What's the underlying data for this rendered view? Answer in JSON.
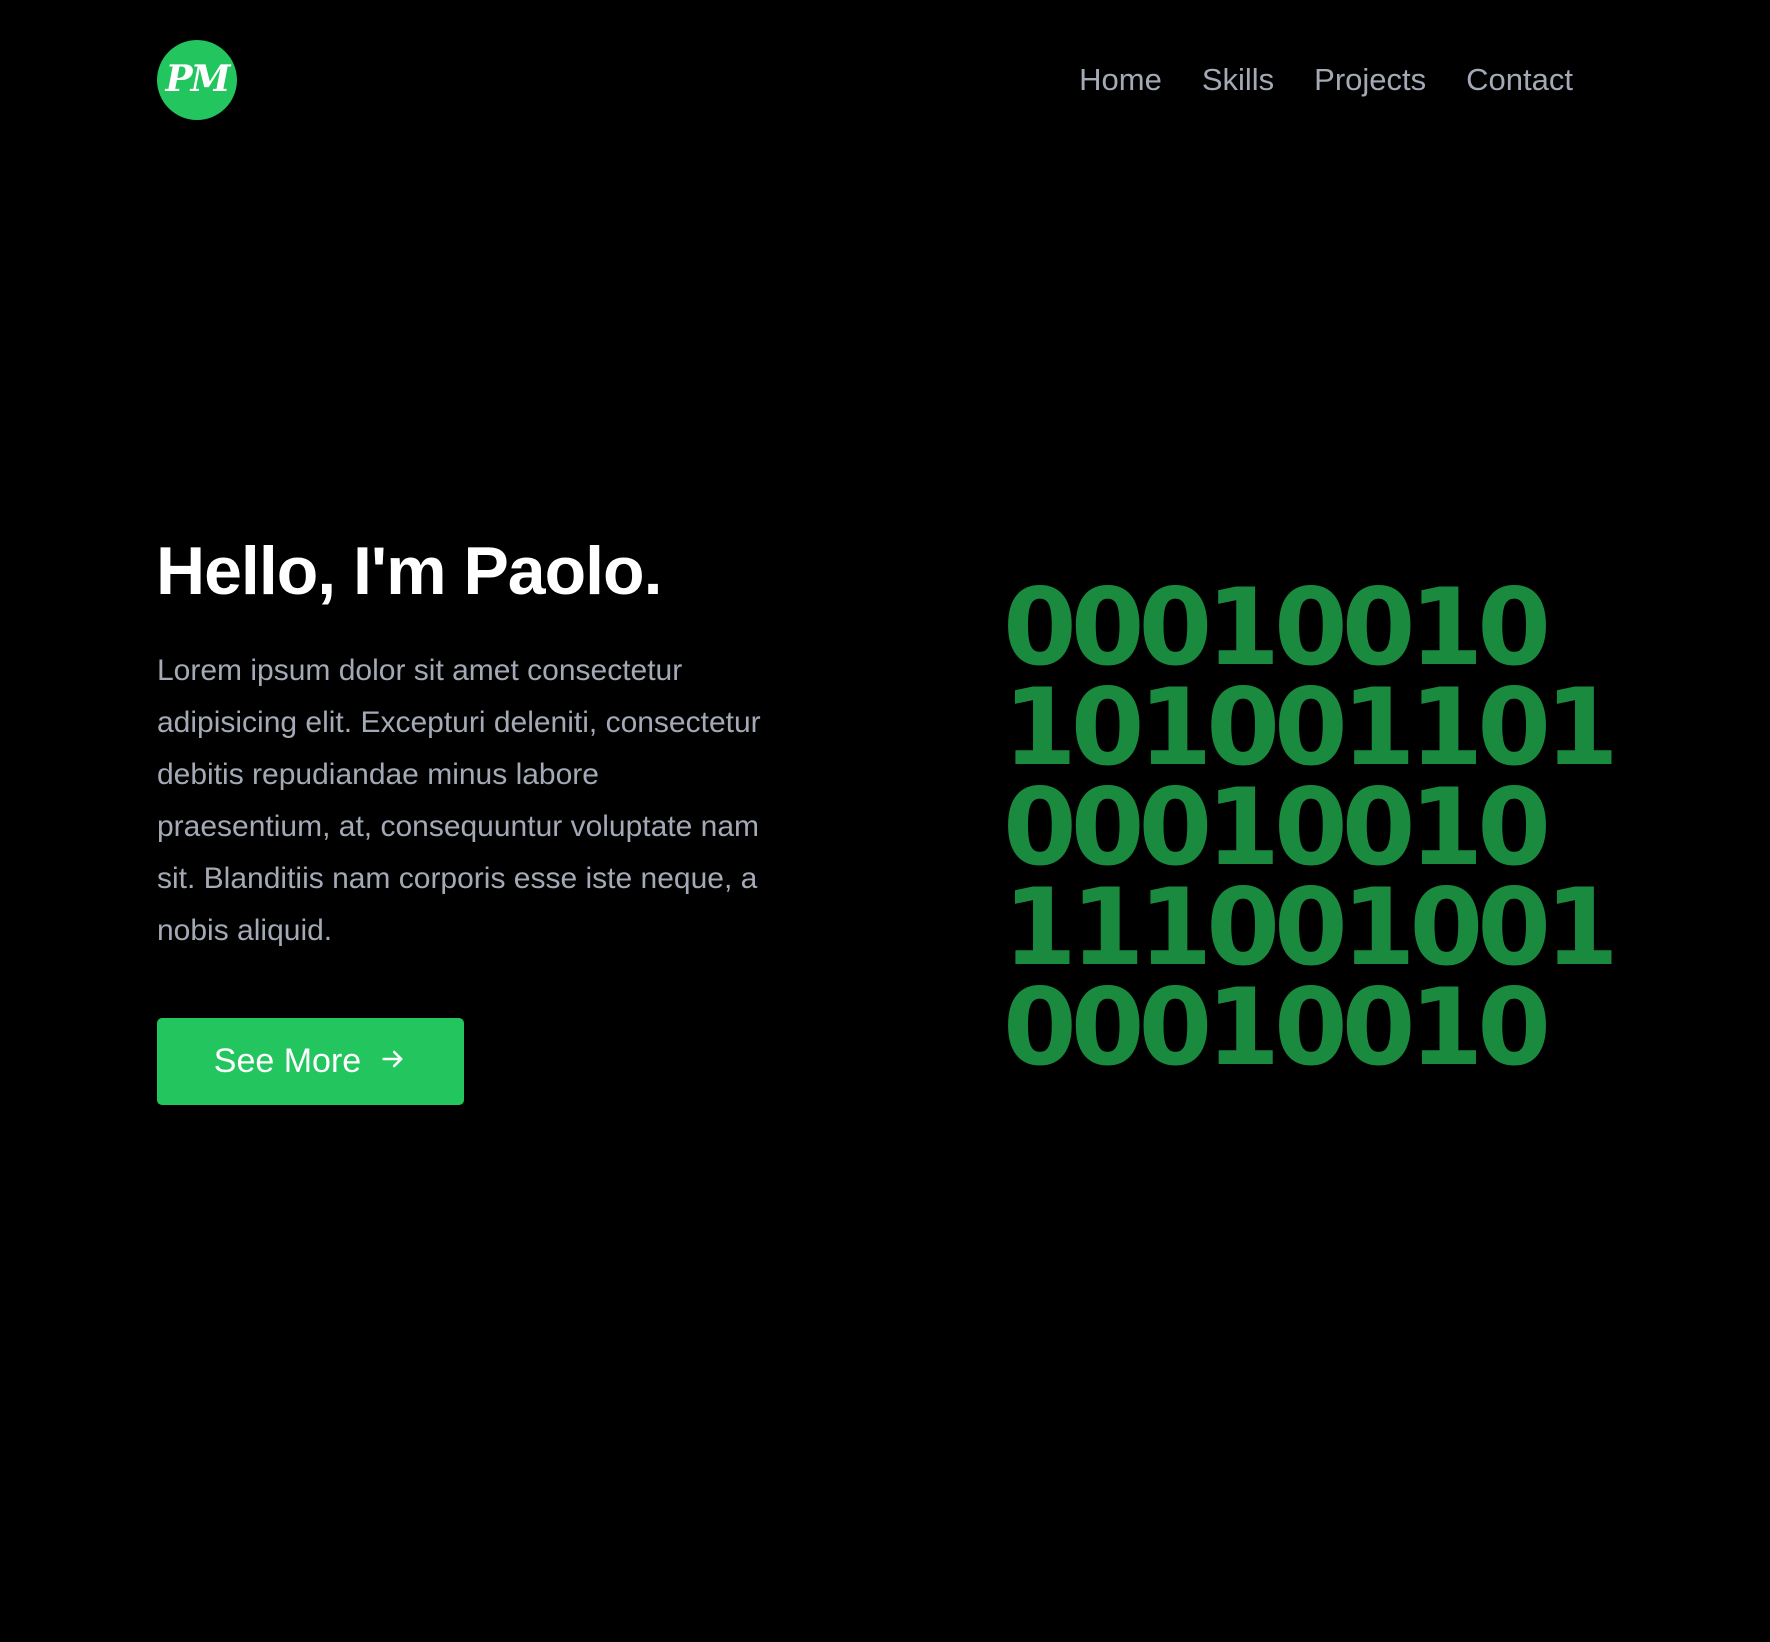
{
  "header": {
    "logo_text": "PM",
    "nav": [
      {
        "label": "Home"
      },
      {
        "label": "Skills"
      },
      {
        "label": "Projects"
      },
      {
        "label": "Contact"
      }
    ]
  },
  "hero": {
    "title": "Hello, I'm Paolo.",
    "description": "Lorem ipsum dolor sit amet consectetur adipisicing elit. Excepturi deleniti, consectetur debitis repudiandae minus labore praesentium, at, consequuntur voluptate nam sit. Blanditiis nam corporis esse iste neque, a nobis aliquid.",
    "button_label": "See More",
    "button_icon": "arrow-right-icon"
  },
  "binary_art": {
    "rows": [
      "00010010",
      "101001101",
      "00010010",
      "111001001",
      "00010010"
    ],
    "color": "#1a8a3f"
  },
  "colors": {
    "background": "#000000",
    "accent": "#22c55e",
    "muted_text": "#a3a9b5",
    "heading": "#ffffff"
  }
}
